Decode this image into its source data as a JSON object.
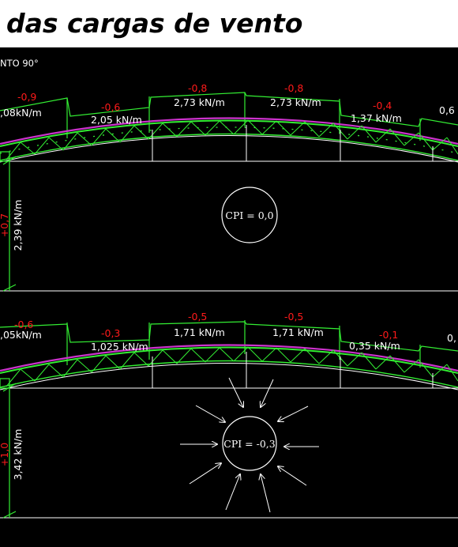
{
  "header": {
    "title": "das cargas de vento"
  },
  "case_label": "NTO 90°",
  "panels": [
    {
      "cpi": "CPI = 0,0",
      "wall_coef": "+0,7",
      "wall_load": "2,39 kN/m",
      "segments": [
        {
          "coef": "-0,9",
          "load": ",08kN/m"
        },
        {
          "coef": "-0,6",
          "load": "2,05 kN/m"
        },
        {
          "coef": "-0,8",
          "load": "2,73 kN/m"
        },
        {
          "coef": "-0,8",
          "load": "2,73 kN/m"
        },
        {
          "coef": "-0,4",
          "load": "1,37 kN/m"
        },
        {
          "coef": "",
          "load": "0,6"
        }
      ]
    },
    {
      "cpi": "CPI = -0,3",
      "wall_coef": "+1,0",
      "wall_load": "3,42 kN/m",
      "segments": [
        {
          "coef": "-0,6",
          "load": ",05kN/m"
        },
        {
          "coef": "-0,3",
          "load": "1,025 kN/m"
        },
        {
          "coef": "-0,5",
          "load": "1,71 kN/m"
        },
        {
          "coef": "-0,5",
          "load": "1,71 kN/m"
        },
        {
          "coef": "-0,1",
          "load": "0,35 kN/m"
        },
        {
          "coef": "",
          "load": "0,"
        }
      ]
    }
  ],
  "colors": {
    "truss": "#33ee33",
    "roof_load_line": "#cc33cc",
    "coefficient": "#ff1a1a",
    "text": "#ffffff"
  }
}
